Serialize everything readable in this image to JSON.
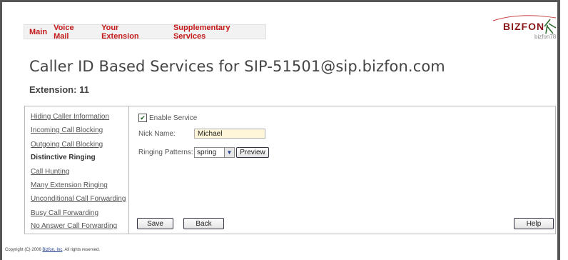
{
  "nav": {
    "items": [
      "Main",
      "Voice Mail",
      "Your Extension",
      "Supplementary Services"
    ]
  },
  "logo": {
    "text": "BIZFON",
    "sub": "bizfon78"
  },
  "page": {
    "title": "Caller ID Based Services for SIP-51501@sip.bizfon.com",
    "extension": "Extension: 11"
  },
  "sidebar": {
    "items": [
      "Hiding Caller Information",
      "Incoming Call Blocking",
      "Outgoing Call Blocking",
      "Distinctive Ringing",
      "Call Hunting",
      "Many Extension Ringing",
      "Unconditional Call Forwarding",
      "Busy Call Forwarding",
      "No Answer Call Forwarding"
    ],
    "active": "Distinctive Ringing"
  },
  "form": {
    "enable_label": "Enable Service",
    "enable_checked": true,
    "nick_label": "Nick Name:",
    "nick_value": "Michael",
    "ringing_label": "Ringing Patterns:",
    "ringing_value": "spring",
    "preview_label": "Preview"
  },
  "actions": {
    "save": "Save",
    "back": "Back",
    "help": "Help"
  },
  "footer": {
    "prefix": "Copyright (C) 2006 ",
    "link": "Bizfon, Inc",
    "suffix": ". All rights reserved."
  },
  "colors": {
    "nav_text": "#c41a1a",
    "input_bg": "#fff6d9",
    "logo": "#8a1818"
  }
}
